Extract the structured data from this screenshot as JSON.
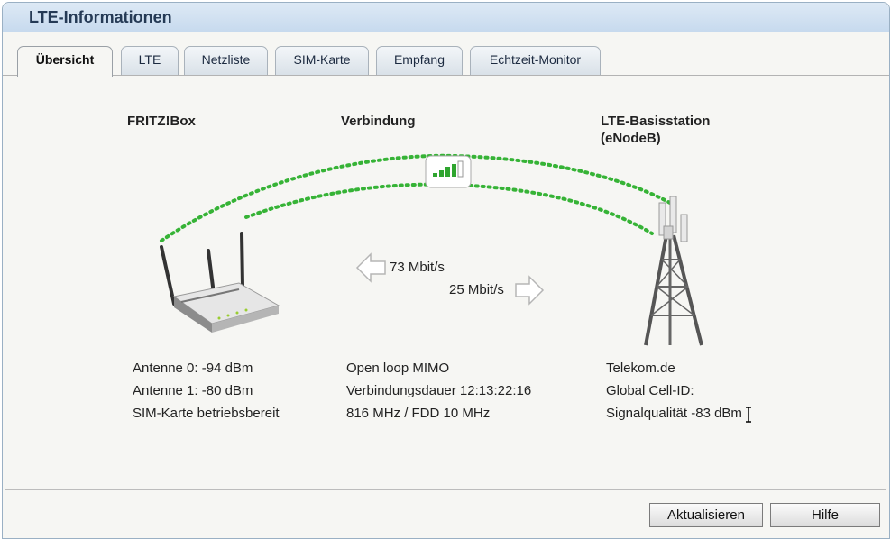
{
  "window": {
    "title": "LTE-Informationen"
  },
  "tabs": [
    {
      "label": "Übersicht",
      "active": true
    },
    {
      "label": "LTE",
      "active": false
    },
    {
      "label": "Netzliste",
      "active": false
    },
    {
      "label": "SIM-Karte",
      "active": false
    },
    {
      "label": "Empfang",
      "active": false
    },
    {
      "label": "Echtzeit-Monitor",
      "active": false
    }
  ],
  "overview": {
    "device_heading": "FRITZ!Box",
    "connection_heading": "Verbindung",
    "station_heading_line1": "LTE-Basisstation",
    "station_heading_line2": "(eNodeB)",
    "downstream": "73 Mbit/s",
    "upstream": "25 Mbit/s",
    "signal_level_bars": 4,
    "signal_total_bars": 5,
    "device_info": [
      "Antenne 0: -94 dBm",
      "Antenne 1: -80 dBm",
      "SIM-Karte betriebsbereit"
    ],
    "connection_info": [
      "Open loop MIMO",
      "Verbindungsdauer 12:13:22:16",
      "816 MHz / FDD 10 MHz"
    ],
    "station_info": [
      "Telekom.de",
      "Global Cell-ID:",
      "Signalqualität -83 dBm"
    ]
  },
  "buttons": {
    "refresh": "Aktualisieren",
    "help": "Hilfe"
  },
  "colors": {
    "link_dots": "#36b336",
    "signal_green": "#2fa52f",
    "title_bar": "#c7daee"
  },
  "icons": [
    "router-icon",
    "cell-tower-icon",
    "signal-strength-icon",
    "arrow-left-icon",
    "arrow-right-icon",
    "text-cursor-icon"
  ]
}
